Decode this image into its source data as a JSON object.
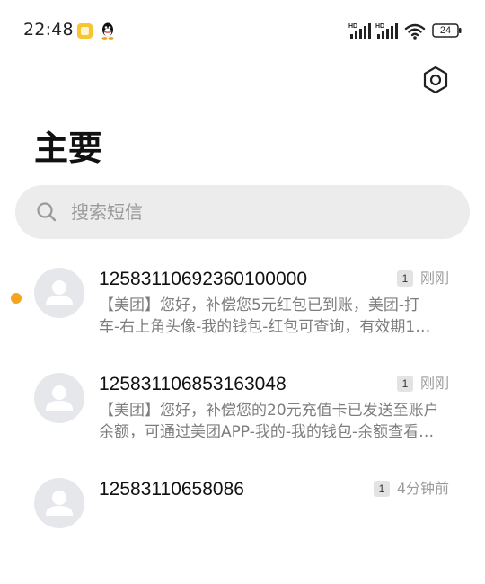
{
  "status_bar": {
    "time": "22:48",
    "battery": "24",
    "signal_badge": "HD",
    "icons": [
      "gallery-notification-icon",
      "qq-icon",
      "hd-signal-icon",
      "hd-signal-icon",
      "wifi-icon",
      "battery-icon"
    ]
  },
  "header": {
    "title": "主要",
    "settings_icon": "gear-icon"
  },
  "search": {
    "placeholder": "搜索短信",
    "icon": "search-icon"
  },
  "messages": [
    {
      "sender": "12583110692360100000",
      "count": "1",
      "time": "刚刚",
      "unread": true,
      "preview_line1": "【美团】您好，补偿您5元红包已到账，美团-打",
      "preview_line2": "车-右上角头像-我的钱包-红包可查询，有效期1…"
    },
    {
      "sender": "125831106853163048",
      "count": "1",
      "time": "刚刚",
      "unread": false,
      "preview_line1": "【美团】您好，补偿您的20元充值卡已发送至账户",
      "preview_line2": "余额，可通过美团APP-我的-我的钱包-余额查看…"
    },
    {
      "sender": "12583110658086",
      "count": "1",
      "time": "4分钟前",
      "unread": false,
      "preview_line1": "",
      "preview_line2": ""
    }
  ],
  "colors": {
    "unread_dot": "#f7a51c",
    "search_bg": "#ececec",
    "secondary_text": "#7d7d7d"
  }
}
